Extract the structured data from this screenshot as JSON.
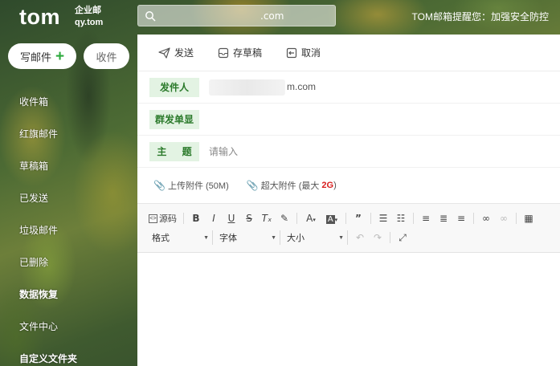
{
  "brand": {
    "logo": "tom",
    "sub_line1": "企业邮",
    "sub_line2": "qy.tom"
  },
  "search": {
    "value": ".com"
  },
  "notice": "TOM邮箱提醒您：加强安全防控",
  "compose_button": {
    "label": "写邮件",
    "plus": "+"
  },
  "receive_button": {
    "label": "收件"
  },
  "nav": {
    "items": [
      {
        "label": "收件箱"
      },
      {
        "label": "红旗邮件"
      },
      {
        "label": "草稿箱"
      },
      {
        "label": "已发送"
      },
      {
        "label": "垃圾邮件"
      },
      {
        "label": "已删除"
      },
      {
        "label": "数据恢复"
      },
      {
        "label": "文件中心"
      },
      {
        "label": "自定义文件夹"
      }
    ]
  },
  "toolbar": {
    "send": "发送",
    "draft": "存草稿",
    "cancel": "取消"
  },
  "compose": {
    "sender_label": "发件人",
    "sender_value": "m.com",
    "group_label": "群发单显",
    "subject_label": "主 题",
    "subject_placeholder": "请输入"
  },
  "attachments": {
    "upload": "上传附件 (50M)",
    "big_prefix": "超大附件 (最大",
    "big_size": "2G",
    "big_suffix": ")"
  },
  "editor": {
    "source_label": "源码",
    "format": "格式",
    "font": "字体",
    "size": "大小"
  }
}
